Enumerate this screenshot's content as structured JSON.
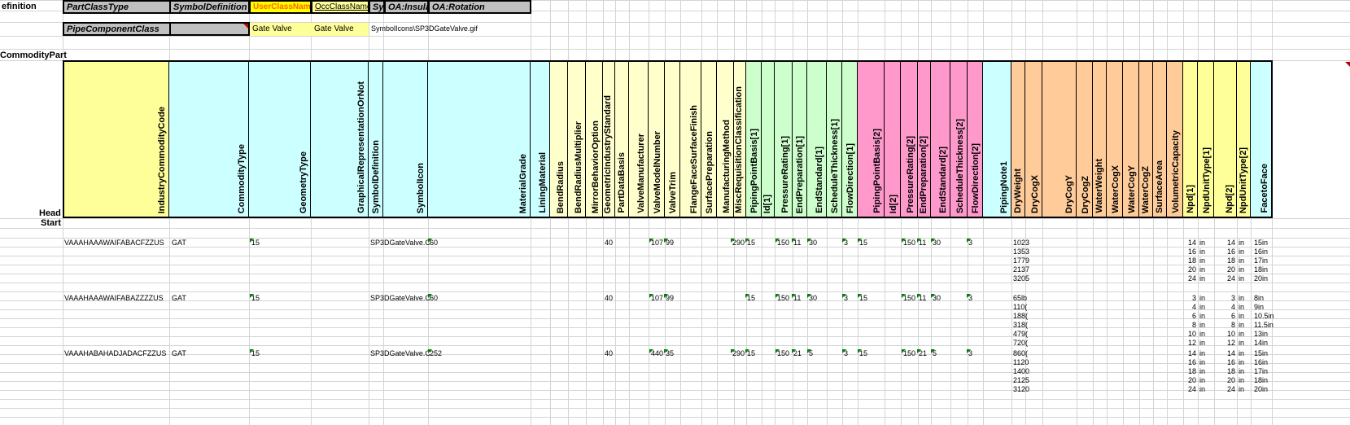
{
  "sheet": {
    "labels": {
      "definition": "efinition",
      "commodity_part": "CommodityPart",
      "head": "Head",
      "start": "Start"
    },
    "def_headers": [
      "PartClassType",
      "SymbolDefinition",
      "UserClassName",
      "OccClassName",
      "Syr",
      "OA:Insula",
      "OA:Rotation"
    ],
    "def_values": {
      "part_class": "PipeComponentClass",
      "user_class": "Gate Valve",
      "occ_class": "Gate Valve",
      "symbol_icon": "SymbolIcons\\SP3DGateValve.gif"
    },
    "columns": [
      "IndustryCommodityCode",
      "CommodityType",
      "GeometryType",
      "GraphicalRepresentationOrNot",
      "SymbolDefinition",
      "SymbolIcon",
      "MaterialGrade",
      "LiningMaterial",
      "BendRadius",
      "BendRadiusMultiplier",
      "MirrorBehaviorOption",
      "GeometricIndustryStandard",
      "PartDataBasis",
      "ValveManufacturer",
      "ValveModelNumber",
      "ValveTrim",
      "FlangeFaceSurfaceFinish",
      "SurfacePreparation",
      "ManufacturingMethod",
      "MiscRequisitionClassification",
      "PipingPointBasis[1]",
      "Id[1]",
      "PressureRating[1]",
      "EndPreparation[1]",
      "EndStandard[1]",
      "ScheduleThickness[1]",
      "FlowDirection[1]",
      "PipingPointBasis[2]",
      "Id[2]",
      "PressureRating[2]",
      "EndPreparation[2]",
      "EndStandard[2]",
      "ScheduleThickness[2]",
      "FlowDirection[2]",
      "PipingNote1",
      "DryWeight",
      "DryCogX",
      "DryCogY",
      "DryCogZ",
      "WaterWeight",
      "WaterCogX",
      "WaterCogY",
      "WaterCogZ",
      "SurfaceArea",
      "VolumetricCapacity",
      "Npd[1]",
      "NpdUnitType[1]",
      "Npd[2]",
      "NpdUnitType[2]",
      "FacetoFace"
    ],
    "parts": [
      {
        "code": "VAAAHAAAWAIFABACFZZUS",
        "ctype": "GAT",
        "geom": "15",
        "symdef": "SP3DGateValve.C",
        "mat": "60",
        "pdb": "40",
        "vm": "107",
        "vmn": "99",
        "misc": "290",
        "ppb1": "15",
        "pr1": "150",
        "ep1": "11",
        "es1": "30",
        "fd1": "3",
        "ppb2": "15",
        "pr2": "150",
        "ep2": "11",
        "es2": "30",
        "fd2": "3",
        "rows": [
          {
            "dw": "1023",
            "npd1": "14",
            "u1": "in",
            "npd2": "14",
            "u2": "in",
            "ftf": "15in"
          },
          {
            "dw": "1353",
            "npd1": "16",
            "u1": "in",
            "npd2": "16",
            "u2": "in",
            "ftf": "16in"
          },
          {
            "dw": "1779",
            "npd1": "18",
            "u1": "in",
            "npd2": "18",
            "u2": "in",
            "ftf": "17in"
          },
          {
            "dw": "2137",
            "npd1": "20",
            "u1": "in",
            "npd2": "20",
            "u2": "in",
            "ftf": "18in"
          },
          {
            "dw": "3205",
            "npd1": "24",
            "u1": "in",
            "npd2": "24",
            "u2": "in",
            "ftf": "20in"
          }
        ]
      },
      {
        "code": "VAAAHAAAWAIFABAZZZZUS",
        "ctype": "GAT",
        "geom": "15",
        "symdef": "SP3DGateValve.C",
        "mat": "60",
        "pdb": "40",
        "vm": "107",
        "vmn": "99",
        "misc": "",
        "ppb1": "15",
        "pr1": "150",
        "ep1": "11",
        "es1": "30",
        "fd1": "3",
        "ppb2": "15",
        "pr2": "150",
        "ep2": "11",
        "es2": "30",
        "fd2": "3",
        "rows": [
          {
            "dw": "65lb",
            "npd1": "3",
            "u1": "in",
            "npd2": "3",
            "u2": "in",
            "ftf": "8in"
          },
          {
            "dw": "110(",
            "npd1": "4",
            "u1": "in",
            "npd2": "4",
            "u2": "in",
            "ftf": "9in"
          },
          {
            "dw": "188(",
            "npd1": "6",
            "u1": "in",
            "npd2": "6",
            "u2": "in",
            "ftf": "10.5in"
          },
          {
            "dw": "318(",
            "npd1": "8",
            "u1": "in",
            "npd2": "8",
            "u2": "in",
            "ftf": "11.5in"
          },
          {
            "dw": "479(",
            "npd1": "10",
            "u1": "in",
            "npd2": "10",
            "u2": "in",
            "ftf": "13in"
          },
          {
            "dw": "720(",
            "npd1": "12",
            "u1": "in",
            "npd2": "12",
            "u2": "in",
            "ftf": "14in"
          }
        ]
      },
      {
        "code": "VAAAHABAHADJADACFZZUS",
        "ctype": "GAT",
        "geom": "15",
        "symdef": "SP3DGateValve.C",
        "mat": "252",
        "pdb": "40",
        "vm": "440",
        "vmn": "35",
        "misc": "290",
        "ppb1": "15",
        "pr1": "150",
        "ep1": "21",
        "es1": "5",
        "fd1": "3",
        "ppb2": "15",
        "pr2": "150",
        "ep2": "21",
        "es2": "5",
        "fd2": "3",
        "rows": [
          {
            "dw": "860(",
            "npd1": "14",
            "u1": "in",
            "npd2": "14",
            "u2": "in",
            "ftf": "15in"
          },
          {
            "dw": "1120",
            "npd1": "16",
            "u1": "in",
            "npd2": "16",
            "u2": "in",
            "ftf": "16in"
          },
          {
            "dw": "1400",
            "npd1": "18",
            "u1": "in",
            "npd2": "18",
            "u2": "in",
            "ftf": "17in"
          },
          {
            "dw": "2125",
            "npd1": "20",
            "u1": "in",
            "npd2": "20",
            "u2": "in",
            "ftf": "18in"
          },
          {
            "dw": "3120",
            "npd1": "24",
            "u1": "in",
            "npd2": "24",
            "u2": "in",
            "ftf": "20in"
          }
        ]
      }
    ]
  }
}
